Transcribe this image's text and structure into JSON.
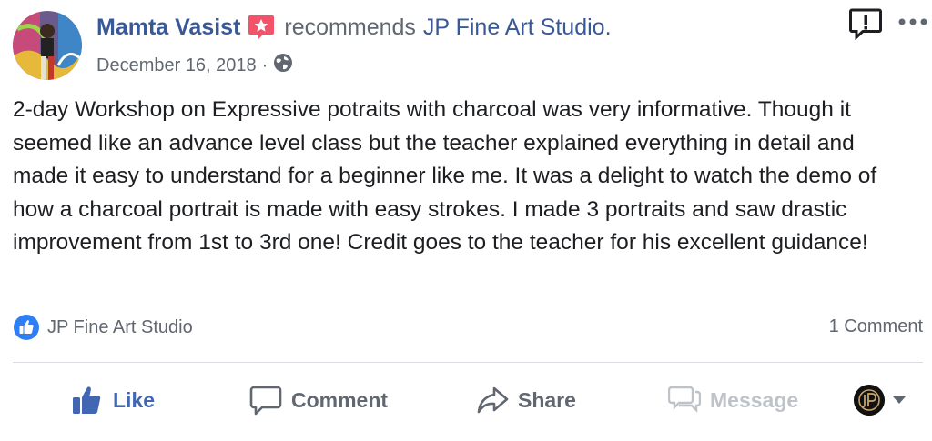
{
  "post": {
    "author": "Mamta Vasist",
    "verb": "recommends",
    "page": "JP Fine Art Studio.",
    "date": "December 16, 2018",
    "separator": "·",
    "body": "2-day Workshop on Expressive potraits with charcoal was very informative. Though it seemed like an advance level class but the teacher explained everything in detail and made it easy to understand for a beginner like me. It was a delight to watch the demo of how a charcoal portrait is made with easy strokes. I made 3 portraits and saw drastic improvement from 1st to 3rd one! Credit goes to the teacher for his excellent guidance!"
  },
  "reactions": {
    "liked_by": "JP Fine Art Studio",
    "comment_count": "1 Comment"
  },
  "actions": {
    "like": "Like",
    "comment": "Comment",
    "share": "Share",
    "message": "Message"
  },
  "icons": {
    "recommend_badge": "recommend-star-icon",
    "audience": "globe-icon",
    "report": "report-icon",
    "more": "more-icon",
    "like_reaction": "like-reaction-icon",
    "like": "thumbs-up-icon",
    "comment": "comment-icon",
    "share": "share-icon",
    "message": "messenger-icon",
    "dropdown": "caret-down-icon"
  },
  "colors": {
    "link_blue": "#385898",
    "like_blue": "#4267b2",
    "badge_red": "#f35369",
    "muted_gray": "#606770",
    "disabled_gray": "#bec3c9"
  }
}
